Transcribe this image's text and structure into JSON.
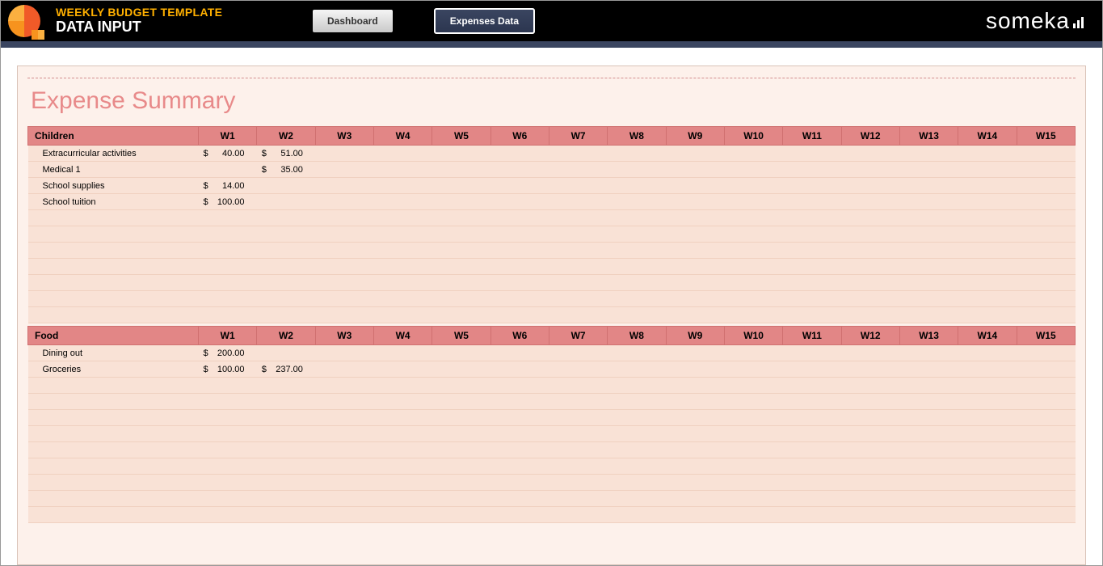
{
  "header": {
    "title": "WEEKLY BUDGET TEMPLATE",
    "subtitle": "DATA INPUT",
    "nav": {
      "dashboard": "Dashboard",
      "expenses": "Expenses Data"
    },
    "brand": "someka"
  },
  "summary": {
    "title": "Expense Summary",
    "weeks": [
      "W1",
      "W2",
      "W3",
      "W4",
      "W5",
      "W6",
      "W7",
      "W8",
      "W9",
      "W10",
      "W11",
      "W12",
      "W13",
      "W14",
      "W15"
    ],
    "sections": [
      {
        "name": "Children",
        "rows": [
          {
            "label": "Extracurricular activities",
            "values": [
              "40.00",
              "51.00",
              "",
              "",
              "",
              "",
              "",
              "",
              "",
              "",
              "",
              "",
              "",
              "",
              ""
            ]
          },
          {
            "label": "Medical 1",
            "values": [
              "",
              "35.00",
              "",
              "",
              "",
              "",
              "",
              "",
              "",
              "",
              "",
              "",
              "",
              "",
              ""
            ]
          },
          {
            "label": "School supplies",
            "values": [
              "14.00",
              "",
              "",
              "",
              "",
              "",
              "",
              "",
              "",
              "",
              "",
              "",
              "",
              "",
              ""
            ]
          },
          {
            "label": "School tuition",
            "values": [
              "100.00",
              "",
              "",
              "",
              "",
              "",
              "",
              "",
              "",
              "",
              "",
              "",
              "",
              "",
              ""
            ]
          }
        ],
        "emptyRows": 7
      },
      {
        "name": "Food",
        "rows": [
          {
            "label": "Dining out",
            "values": [
              "200.00",
              "",
              "",
              "",
              "",
              "",
              "",
              "",
              "",
              "",
              "",
              "",
              "",
              "",
              ""
            ]
          },
          {
            "label": "Groceries",
            "values": [
              "100.00",
              "237.00",
              "",
              "",
              "",
              "",
              "",
              "",
              "",
              "",
              "",
              "",
              "",
              "",
              ""
            ]
          }
        ],
        "emptyRows": 9
      }
    ],
    "currency": "$"
  }
}
